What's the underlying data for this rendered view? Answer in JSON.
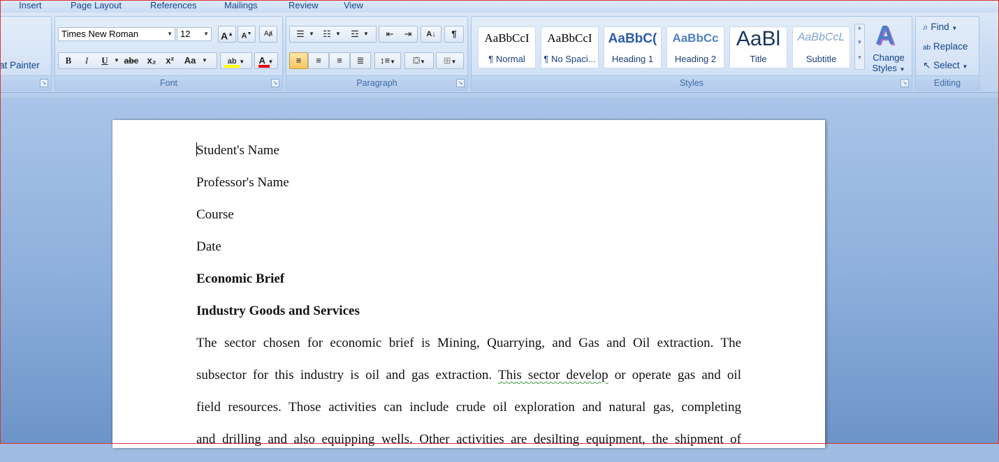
{
  "tabs": [
    "Insert",
    "Page Layout",
    "References",
    "Mailings",
    "Review",
    "View"
  ],
  "clipboard": {
    "format_painter_label": "at Painter"
  },
  "font": {
    "family": "Times New Roman",
    "size": "12",
    "group_label": "Font",
    "bold": "B",
    "italic": "I",
    "underline": "U",
    "strike": "abe",
    "subscript": "x₂",
    "superscript": "x²",
    "change_case": "Aa",
    "grow": "A",
    "shrink": "A",
    "highlight_color": "#ffff00",
    "font_color": "#e00000"
  },
  "paragraph": {
    "group_label": "Paragraph",
    "sort": "A↓",
    "pilcrow": "¶"
  },
  "styles": {
    "group_label": "Styles",
    "items": [
      {
        "sample": "AaBbCcI",
        "name": "¶ Normal"
      },
      {
        "sample": "AaBbCcI",
        "name": "¶ No Spaci..."
      },
      {
        "sample": "AaBbC(",
        "name": "Heading 1"
      },
      {
        "sample": "AaBbCc",
        "name": "Heading 2"
      },
      {
        "sample": "AaBl",
        "name": "Title"
      },
      {
        "sample": "AaBbCcL",
        "name": "Subtitle"
      }
    ],
    "change_styles_line1": "Change",
    "change_styles_line2": "Styles"
  },
  "editing": {
    "group_label": "Editing",
    "find": "Find",
    "replace": "Replace",
    "select": "Select"
  },
  "document": {
    "lines": [
      "Student's Name",
      "Professor's Name",
      "Course",
      "Date"
    ],
    "heading1": "Economic Brief",
    "heading2": "Industry Goods and Services",
    "para": {
      "l1": "The sector chosen for economic brief is Mining, Quarrying, and Gas and Oil extraction. The",
      "l2a": "subsector for this industry is oil and gas extraction. ",
      "l2b": "This sector develop",
      "l2c": " or operate gas and oil",
      "l3": "field resources. Those activities can include crude oil exploration and natural gas, completing",
      "l4": "and drilling and also equipping wells. Other activities are desilting equipment, the shipment of"
    }
  }
}
